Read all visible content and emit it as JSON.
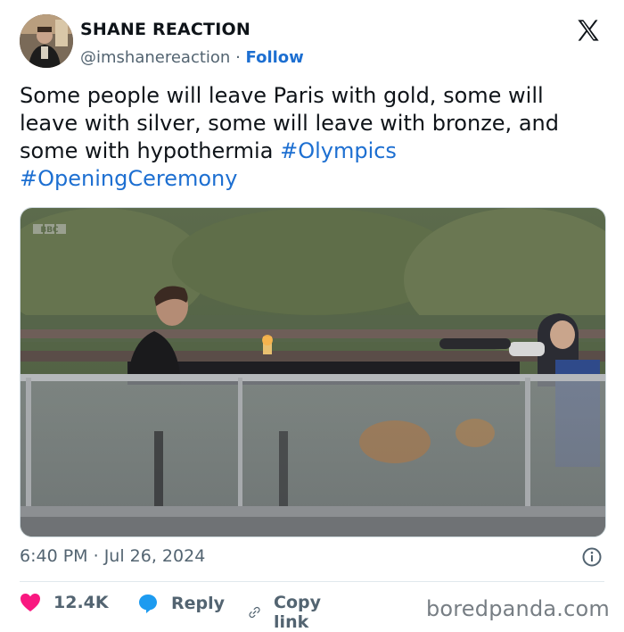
{
  "author": {
    "display_name": "SHANE REACTION",
    "handle": "@imshanereaction",
    "separator": "·",
    "follow_label": "Follow"
  },
  "tweet": {
    "text_plain": "Some people will leave Paris with gold, some will leave with silver, some will leave with bronze, and some with hypothermia",
    "hashtags": [
      "#Olympics",
      "#OpeningCeremony"
    ],
    "time": "6:40 PM",
    "date": "Jul 26, 2024",
    "meta_separator": "·"
  },
  "media": {
    "broadcaster_logo": "BBC"
  },
  "actions": {
    "like_count": "12.4K",
    "reply_label": "Reply",
    "copy_label": "Copy link"
  },
  "icons": {
    "platform": "x-logo-icon",
    "info": "info-icon",
    "like": "heart-icon",
    "reply": "reply-bubble-icon",
    "copy": "link-icon"
  },
  "colors": {
    "link": "#1d6fd1",
    "heart": "#f91880",
    "reply": "#1d9bf0",
    "muted": "#536471"
  },
  "watermark": "boredpanda.com"
}
